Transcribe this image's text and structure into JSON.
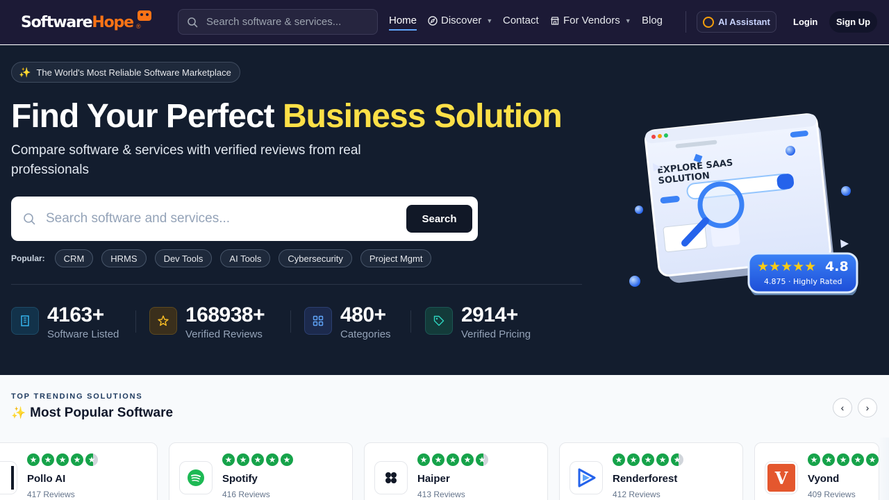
{
  "nav": {
    "logo_part1": "Software",
    "logo_part2": "Hope",
    "logo_reg": "®",
    "search_placeholder": "Search software & services...",
    "links": [
      {
        "label": "Home",
        "active": true
      },
      {
        "label": "Discover",
        "icon": "compass-icon",
        "dropdown": true
      },
      {
        "label": "Contact"
      },
      {
        "label": "For Vendors",
        "icon": "store-icon",
        "dropdown": true
      },
      {
        "label": "Blog"
      }
    ],
    "ai_label": "AI Assistant",
    "login_label": "Login",
    "signup_label": "Sign Up"
  },
  "hero": {
    "badge": "The World's Most Reliable Software Marketplace",
    "title_plain": "Find Your Perfect ",
    "title_highlight": "Business Solution",
    "subtitle": "Compare software & services with verified reviews from real professionals",
    "search_placeholder": "Search software and services...",
    "search_button": "Search",
    "popular_label": "Popular:",
    "popular_tags": [
      "CRM",
      "HRMS",
      "Dev Tools",
      "AI Tools",
      "Cybersecurity",
      "Project Mgmt"
    ],
    "stats": [
      {
        "value": "4163+",
        "label": "Software Listed",
        "icon": "building-icon",
        "color": "#38bdf8"
      },
      {
        "value": "168938+",
        "label": "Verified Reviews",
        "icon": "star-icon",
        "color": "#fbbf24"
      },
      {
        "value": "480+",
        "label": "Categories",
        "icon": "grid-icon",
        "color": "#60a5fa"
      },
      {
        "value": "2914+",
        "label": "Verified Pricing",
        "icon": "tag-icon",
        "color": "#2dd4bf"
      }
    ]
  },
  "illustration": {
    "heading_line1": "EXPLORE SAAS",
    "heading_line2": "SOLUTION",
    "rating": "4.8",
    "rating_caption": "4.875 · Highly Rated"
  },
  "trending": {
    "eyebrow": "TOP TRENDING SOLUTIONS",
    "title": "Most Popular Software",
    "cards": [
      {
        "name": "Pollo AI",
        "reviews": "417 Reviews",
        "rating": 4.5
      },
      {
        "name": "Spotify",
        "reviews": "416 Reviews",
        "rating": 4.9
      },
      {
        "name": "Haiper",
        "reviews": "413 Reviews",
        "rating": 4.5
      },
      {
        "name": "Renderforest",
        "reviews": "412 Reviews",
        "rating": 4.5
      },
      {
        "name": "Vyond",
        "reviews": "409 Reviews",
        "rating": 4.9
      }
    ]
  },
  "colors": {
    "nav_bg": "#1c1a36",
    "hero_bg": "#131d2e",
    "highlight": "#fde047",
    "star_green": "#16a34a"
  }
}
